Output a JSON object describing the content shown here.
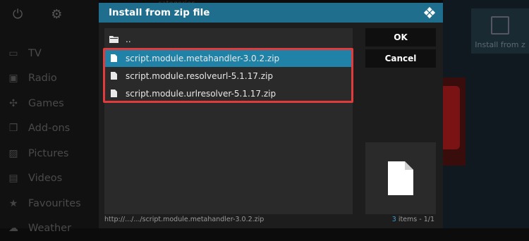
{
  "background": {
    "category_label": "categories",
    "top_icons": [
      {
        "name": "power-icon",
        "glyph": "⏻"
      },
      {
        "name": "gear-icon",
        "glyph": "⚙"
      }
    ],
    "nav": [
      {
        "label": "TV",
        "icon": "tv-icon",
        "glyph": "▭"
      },
      {
        "label": "Radio",
        "icon": "radio-icon",
        "glyph": "▣"
      },
      {
        "label": "Games",
        "icon": "gamepad-icon",
        "glyph": "✣"
      },
      {
        "label": "Add-ons",
        "icon": "addons-box-icon",
        "glyph": "❒"
      },
      {
        "label": "Pictures",
        "icon": "pictures-icon",
        "glyph": "▨"
      },
      {
        "label": "Videos",
        "icon": "videos-icon",
        "glyph": "▤"
      },
      {
        "label": "Favourites",
        "icon": "star-icon",
        "glyph": "★"
      },
      {
        "label": "Weather",
        "icon": "weather-icon",
        "glyph": "☁"
      }
    ],
    "tile_label": "Install from z"
  },
  "dialog": {
    "title": "Install from zip file",
    "parent_label": "..",
    "files": [
      {
        "label": "script.module.metahandler-3.0.2.zip",
        "selected": true
      },
      {
        "label": "script.module.resolveurl-5.1.17.zip",
        "selected": false
      },
      {
        "label": "script.module.urlresolver-5.1.17.zip",
        "selected": false
      }
    ],
    "ok_label": "OK",
    "cancel_label": "Cancel",
    "path": "http://.../.../script.module.metahandler-3.0.2.zip",
    "count_num": "3",
    "count_text": " items - 1/1"
  },
  "colors": {
    "header": "#1f6e8e",
    "selected": "#1f82a6",
    "highlight": "#e23b3b"
  }
}
